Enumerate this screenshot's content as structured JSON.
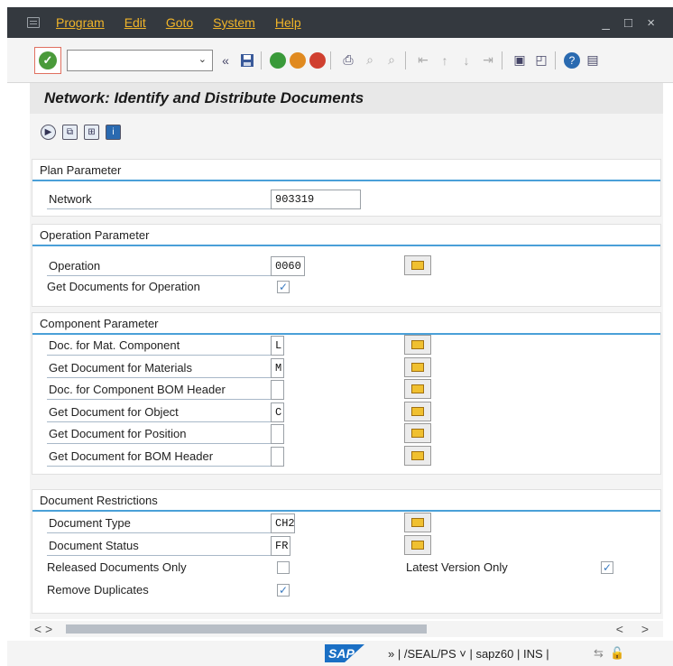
{
  "menu": {
    "items": [
      "Program",
      "Edit",
      "Goto",
      "System",
      "Help"
    ],
    "window_controls": "_ □ ×"
  },
  "toolbar": {
    "command_value": ""
  },
  "title": "Network: Identify and Distribute Documents",
  "sections": {
    "plan": {
      "header": "Plan Parameter",
      "network_label": "Network",
      "network_value": "903319"
    },
    "operation": {
      "header": "Operation Parameter",
      "operation_label": "Operation",
      "operation_value": "0060",
      "get_docs_label": "Get Documents for Operation",
      "get_docs_checked": true
    },
    "component": {
      "header": "Component Parameter",
      "rows": [
        {
          "label": "Doc. for Mat. Component",
          "value": "L"
        },
        {
          "label": "Get Document for Materials",
          "value": "M"
        },
        {
          "label": "Doc. for Component BOM Header",
          "value": ""
        },
        {
          "label": "Get Document for Object",
          "value": "C"
        },
        {
          "label": "Get Document for Position",
          "value": ""
        },
        {
          "label": "Get Document for BOM Header",
          "value": ""
        }
      ]
    },
    "restrictions": {
      "header": "Document Restrictions",
      "doc_type_label": "Document Type",
      "doc_type_value": "CH2",
      "doc_status_label": "Document Status",
      "doc_status_value": "FR",
      "released_label": "Released Documents Only",
      "released_checked": false,
      "latest_label": "Latest Version Only",
      "latest_checked": true,
      "remove_dup_label": "Remove Duplicates",
      "remove_dup_checked": true
    }
  },
  "scrollbar": {
    "left_arrows": "< >",
    "right_arrows": "< >"
  },
  "statusbar": {
    "logo": "SAP",
    "text": "» | /SEAL/PS ˅ | sapz60 | INS |"
  },
  "colors": {
    "menubar_bg": "#34393f",
    "menu_text": "#f0b429",
    "group_accent": "#4aa0d8",
    "sap_blue": "#1a6fc4"
  }
}
